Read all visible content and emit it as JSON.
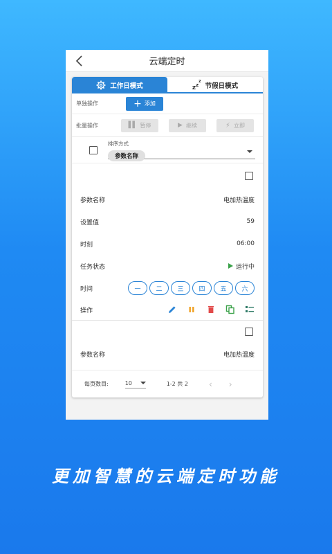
{
  "appbar": {
    "title": "云端定时"
  },
  "tabs": [
    {
      "label": "工作日模式",
      "icon": "gear-icon",
      "active": true
    },
    {
      "label": "节假日模式",
      "icon": "sleep-icon",
      "active": false
    }
  ],
  "single_op": {
    "label": "单独操作",
    "add_label": "添加"
  },
  "batch_op": {
    "label": "批量操作",
    "pause_label": "暂停",
    "continue_label": "继续",
    "now_label": "立即"
  },
  "sort": {
    "caption": "排序方式",
    "value": "参数名称"
  },
  "item1": {
    "param_label": "参数名称",
    "param_value": "电加热温度",
    "set_label": "设置值",
    "set_value": "59",
    "moment_label": "时刻",
    "moment_value": "06:00",
    "status_label": "任务状态",
    "status_value": "运行中",
    "time_label": "时间",
    "days": [
      "一",
      "二",
      "三",
      "四",
      "五",
      "六"
    ],
    "ops_label": "操作"
  },
  "item2": {
    "param_label": "参数名称",
    "param_value": "电加热温度"
  },
  "pager": {
    "per_page_label": "每页数目:",
    "per_page_value": "10",
    "range": "1-2 共 2"
  },
  "tagline": "更加智慧的云端定时功能",
  "colors": {
    "accent": "#2a84d6",
    "edit": "#2a84d6",
    "pause": "#f0a020",
    "delete": "#e24a4a",
    "copy": "#3ba24a",
    "run": "#3ba24a"
  }
}
